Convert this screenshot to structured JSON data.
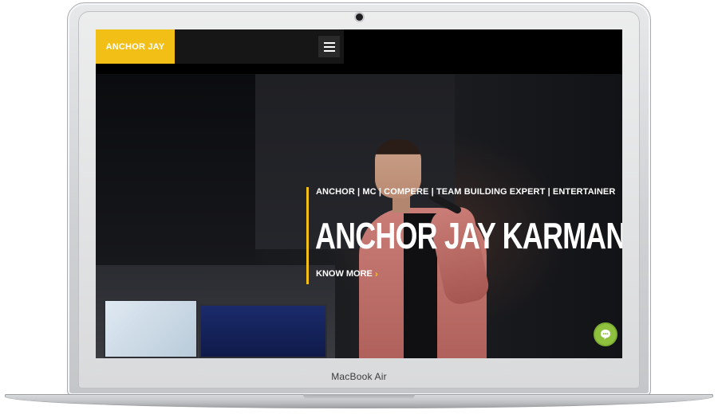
{
  "device": {
    "brand_label": "MacBook Air"
  },
  "site": {
    "logo": "ANCHOR JAY",
    "menu_icon": "hamburger-menu-icon"
  },
  "hero": {
    "tagline": "ANCHOR | MC | COMPERE | TEAM BUILDING EXPERT | ENTERTAINER",
    "title": "ANCHOR JAY KARMANI",
    "cta_label": "KNOW MORE",
    "cta_icon": "chevron-right-icon"
  },
  "chat": {
    "icon": "chat-bubble-icon"
  },
  "colors": {
    "accent": "#f2bf17",
    "topbar": "#000000",
    "chat": "#8fc13f"
  }
}
